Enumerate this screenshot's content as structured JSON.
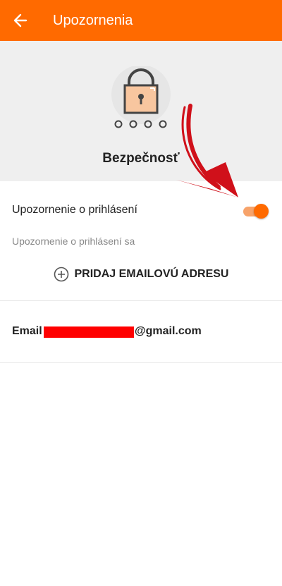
{
  "appbar": {
    "title": "Upozornenia",
    "back_icon": "arrow-left-icon"
  },
  "hero": {
    "icon": "lock-icon",
    "title": "Bezpečnosť"
  },
  "login_alert": {
    "label": "Upozornenie o prihlásení",
    "enabled": true,
    "description": "Upozornenie o prihlásení sa"
  },
  "add_email": {
    "icon": "plus-circle-icon",
    "label": "PRIDAJ EMAILOVÚ ADRESU"
  },
  "email_entry": {
    "label": "Email",
    "domain": "@gmail.com"
  },
  "colors": {
    "accent": "#ff6a00",
    "hero_bg": "#efefef",
    "redaction": "#ff0000",
    "annotation_arrow": "#d0101a"
  }
}
